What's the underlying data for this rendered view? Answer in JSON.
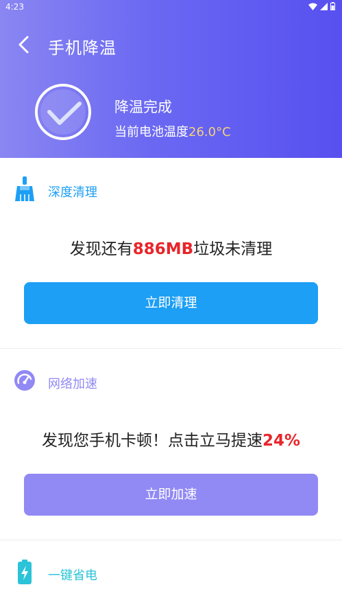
{
  "status_bar": {
    "time": "4:23"
  },
  "header": {
    "title": "手机降温",
    "done_text": "降温完成",
    "temp_prefix": "当前电池温度",
    "temp_value": "26.0°C"
  },
  "sections": {
    "clean": {
      "label": "深度清理",
      "msg_prefix": "发现还有",
      "msg_highlight": "886MB",
      "msg_suffix": "垃圾未清理",
      "button_label": "立即清理",
      "accent_color": "#1d9ff5"
    },
    "network": {
      "label": "网络加速",
      "msg_prefix": "发现您手机卡顿！点击立马提速",
      "msg_highlight": "24%",
      "button_label": "立即加速",
      "accent_color": "#9189f4"
    },
    "battery": {
      "label": "一键省电",
      "accent_color": "#2bc3d8"
    }
  },
  "colors": {
    "header_gradient_start": "#8a86f2",
    "header_gradient_end": "#5750f0",
    "highlight_red": "#e8252a",
    "temp_yellow": "#f5d27a"
  },
  "icons": {
    "back": "back-arrow-icon",
    "done": "checkmark-circle-icon",
    "clean": "broom-icon",
    "network": "speedometer-icon",
    "battery": "battery-charging-icon"
  }
}
